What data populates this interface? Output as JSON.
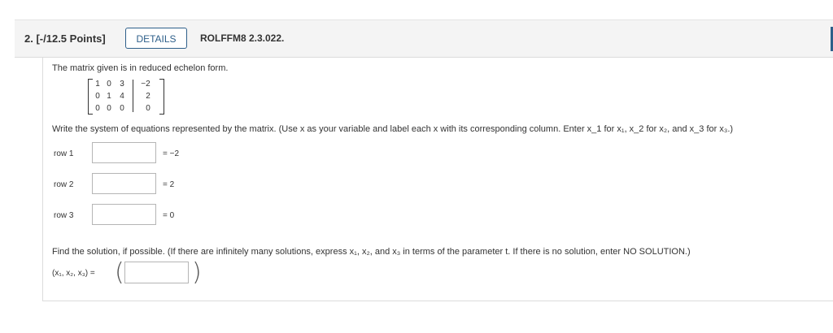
{
  "header": {
    "question_number": "2.",
    "points": "[-/12.5 Points]",
    "details_label": "DETAILS",
    "reference": "ROLFFM8 2.3.022."
  },
  "prompt": {
    "intro": "The matrix given is in reduced echelon form.",
    "instruction_main": "Write the system of equations represented by the matrix. (Use x as your variable and label each x with its corresponding column. Enter x_1 for x₁, x_2 for x₂, and x_3 for x₃.)",
    "solution_instruction": "Find the solution, if possible. (If there are infinitely many solutions, express x₁, x₂, and x₃ in terms of the parameter t. If there is no solution, enter NO SOLUTION.)"
  },
  "matrix": {
    "rows": [
      [
        "1",
        "0",
        "3",
        "−2"
      ],
      [
        "0",
        "1",
        "4",
        "2"
      ],
      [
        "0",
        "0",
        "0",
        "0"
      ]
    ]
  },
  "equations": [
    {
      "label": "row 1",
      "rhs": "= −2",
      "value": ""
    },
    {
      "label": "row 2",
      "rhs": "= 2",
      "value": ""
    },
    {
      "label": "row 3",
      "rhs": "= 0",
      "value": ""
    }
  ],
  "solution": {
    "tuple_label": "(x₁, x₂, x₃) =",
    "value": ""
  }
}
